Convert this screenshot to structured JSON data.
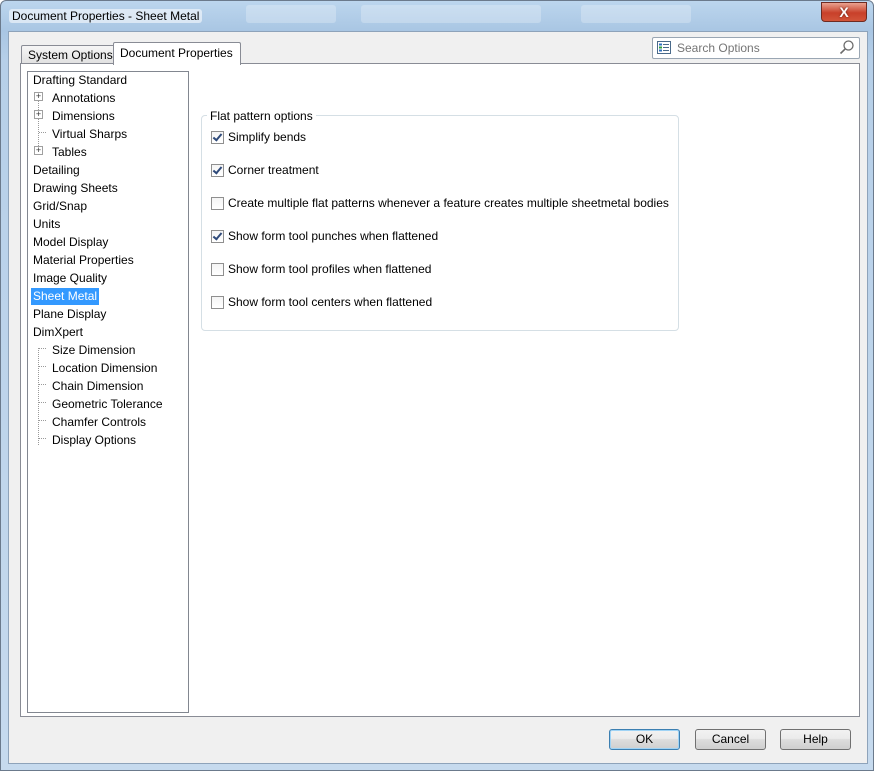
{
  "window": {
    "title": "Document Properties - Sheet Metal",
    "close_label": "X"
  },
  "tabs": [
    {
      "label": "System Options",
      "active": false
    },
    {
      "label": "Document Properties",
      "active": true
    }
  ],
  "search": {
    "placeholder": "Search Options",
    "icons": [
      "options-list-icon",
      "magnifier-icon"
    ]
  },
  "tree": {
    "items": [
      {
        "label": "Drafting Standard",
        "level": 0
      },
      {
        "label": "Annotations",
        "level": 1,
        "expandable": true
      },
      {
        "label": "Dimensions",
        "level": 1,
        "expandable": true
      },
      {
        "label": "Virtual Sharps",
        "level": 1
      },
      {
        "label": "Tables",
        "level": 1,
        "expandable": true
      },
      {
        "label": "Detailing",
        "level": 0
      },
      {
        "label": "Drawing Sheets",
        "level": 0
      },
      {
        "label": "Grid/Snap",
        "level": 0
      },
      {
        "label": "Units",
        "level": 0
      },
      {
        "label": "Model Display",
        "level": 0
      },
      {
        "label": "Material Properties",
        "level": 0
      },
      {
        "label": "Image Quality",
        "level": 0
      },
      {
        "label": "Sheet Metal",
        "level": 0,
        "selected": true
      },
      {
        "label": "Plane Display",
        "level": 0
      },
      {
        "label": "DimXpert",
        "level": 0
      },
      {
        "label": "Size Dimension",
        "level": 1
      },
      {
        "label": "Location Dimension",
        "level": 1
      },
      {
        "label": "Chain Dimension",
        "level": 1
      },
      {
        "label": "Geometric Tolerance",
        "level": 1
      },
      {
        "label": "Chamfer Controls",
        "level": 1
      },
      {
        "label": "Display Options",
        "level": 1
      }
    ]
  },
  "flat_pattern": {
    "group_label": "Flat pattern options",
    "options": [
      {
        "label": "Simplify bends",
        "checked": true
      },
      {
        "label": "Corner treatment",
        "checked": true
      },
      {
        "label": "Create multiple flat patterns whenever a feature creates multiple sheetmetal bodies",
        "checked": false
      },
      {
        "label": "Show form tool punches when flattened",
        "checked": true
      },
      {
        "label": "Show form tool profiles when flattened",
        "checked": false
      },
      {
        "label": "Show form tool centers when flattened",
        "checked": false
      }
    ]
  },
  "buttons": {
    "ok": "OK",
    "cancel": "Cancel",
    "help": "Help"
  },
  "colors": {
    "selection": "#3399ff",
    "title_bar": "#a9c6e3",
    "close_button": "#c8402a"
  }
}
